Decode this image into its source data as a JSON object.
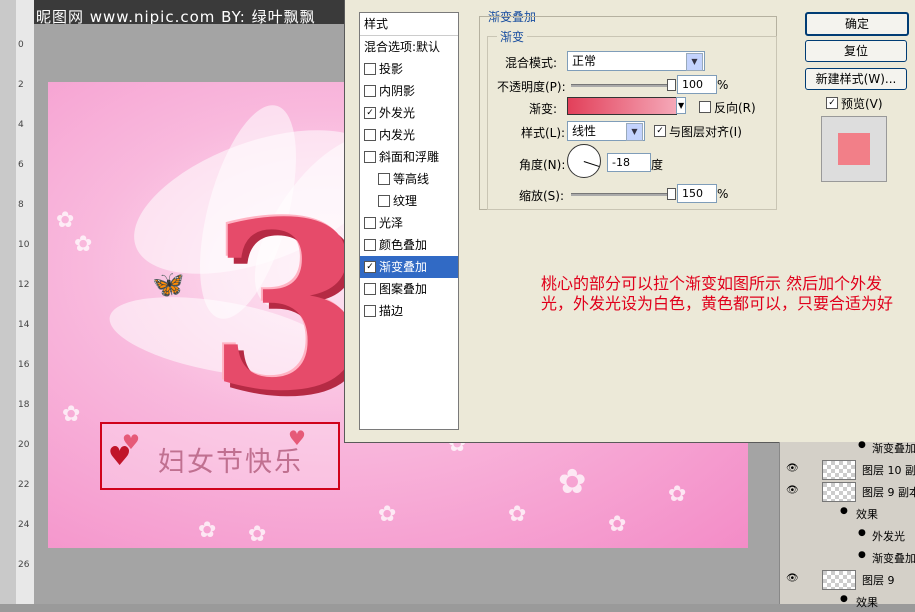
{
  "watermark": "昵图网 www.nipic.com      BY: 绿叶飘飘",
  "ruler_numbers": [
    "0",
    "2",
    "4",
    "6",
    "8",
    "10",
    "12",
    "14",
    "16",
    "18",
    "20",
    "22",
    "24",
    "26"
  ],
  "canvas": {
    "big_number": "3",
    "banner_text": "妇女节快乐"
  },
  "dialog": {
    "style_list_header": "样式",
    "style_list": [
      {
        "label": "混合选项:默认",
        "checkbox": false,
        "checked": false,
        "indent": false,
        "selected": false
      },
      {
        "label": "投影",
        "checkbox": true,
        "checked": false,
        "indent": false,
        "selected": false
      },
      {
        "label": "内阴影",
        "checkbox": true,
        "checked": false,
        "indent": false,
        "selected": false
      },
      {
        "label": "外发光",
        "checkbox": true,
        "checked": true,
        "indent": false,
        "selected": false
      },
      {
        "label": "内发光",
        "checkbox": true,
        "checked": false,
        "indent": false,
        "selected": false
      },
      {
        "label": "斜面和浮雕",
        "checkbox": true,
        "checked": false,
        "indent": false,
        "selected": false
      },
      {
        "label": "等高线",
        "checkbox": true,
        "checked": false,
        "indent": true,
        "selected": false
      },
      {
        "label": "纹理",
        "checkbox": true,
        "checked": false,
        "indent": true,
        "selected": false
      },
      {
        "label": "光泽",
        "checkbox": true,
        "checked": false,
        "indent": false,
        "selected": false
      },
      {
        "label": "颜色叠加",
        "checkbox": true,
        "checked": false,
        "indent": false,
        "selected": false
      },
      {
        "label": "渐变叠加",
        "checkbox": true,
        "checked": true,
        "indent": false,
        "selected": true
      },
      {
        "label": "图案叠加",
        "checkbox": true,
        "checked": false,
        "indent": false,
        "selected": false
      },
      {
        "label": "描边",
        "checkbox": true,
        "checked": false,
        "indent": false,
        "selected": false
      }
    ],
    "section_title": "渐变叠加",
    "group_title": "渐变",
    "blend_mode_label": "混合模式:",
    "blend_mode_value": "正常",
    "opacity_label": "不透明度(P):",
    "opacity_value": "100",
    "opacity_unit": "%",
    "opacity_level": 1.0,
    "gradient_label": "渐变:",
    "reverse_label": "反向(R)",
    "reverse_checked": false,
    "style_label": "样式(L):",
    "style_value": "线性",
    "align_label": "与图层对齐(I)",
    "align_checked": true,
    "angle_label": "角度(N):",
    "angle_value": "-18",
    "angle_unit": "度",
    "scale_label": "缩放(S):",
    "scale_value": "150",
    "scale_unit": "%",
    "scale_level": 1.0,
    "buttons": {
      "ok": "确定",
      "reset": "复位",
      "new_style": "新建样式(W)..."
    },
    "preview_label": "预览(V)",
    "preview_checked": true,
    "preview_color": "#f27f88",
    "annotation": "桃心的部分可以拉个渐变如图所示 然后加个外发光，外发光设为白色，黄色都可以，只要合适为好"
  },
  "layers": [
    {
      "label": "渐变叠加",
      "type": "effect"
    },
    {
      "label": "图层 10 副本",
      "type": "layer"
    },
    {
      "label": "图层 9 副本",
      "type": "layer"
    },
    {
      "label": "效果",
      "type": "effects-header"
    },
    {
      "label": "外发光",
      "type": "effect"
    },
    {
      "label": "渐变叠加",
      "type": "effect"
    },
    {
      "label": "图层 9",
      "type": "layer"
    },
    {
      "label": "效果",
      "type": "effects-header"
    }
  ],
  "colors": {
    "accent_blue": "#316ac5",
    "annotation_red": "#e0001b",
    "gradient_start": "#e2405a",
    "gradient_end": "#f5a8b8"
  }
}
